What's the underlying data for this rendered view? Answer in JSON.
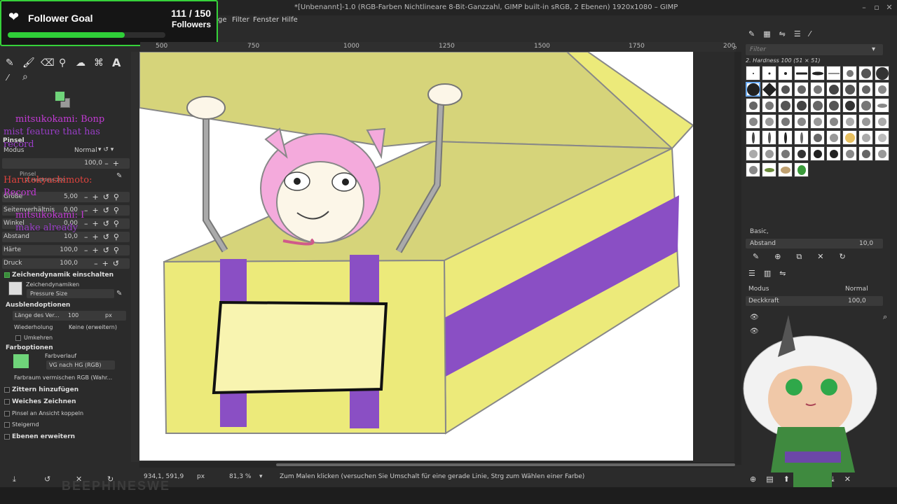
{
  "window": {
    "title": "*[Unbenannt]-1.0 (RGB-Farben Nichtlineare 8-Bit-Ganzzahl, GIMP built-in sRGB, 2 Ebenen) 1920x1080 – GIMP"
  },
  "menu": [
    "Filter",
    "Fenster",
    "Hilfe"
  ],
  "menu_partial": "ge",
  "follower_goal": {
    "title": "Follower Goal",
    "count": "111 / 150",
    "unit": "Followers",
    "progress": 0.74,
    "accent": "#2fcf38"
  },
  "ruler_labels": [
    "500",
    "750",
    "1000",
    "1250",
    "1500",
    "1750",
    "200"
  ],
  "tool_options": {
    "header": "Pinsel",
    "mode_label": "Modus",
    "mode_value": "Normal",
    "opacity_value": "100,0",
    "brush_label": "Pinsel",
    "brush_value": "2. Hardness 100",
    "size_label": "Größe",
    "size_value": "5,00",
    "ratio_label": "Seitenverhältnis",
    "ratio_value": "0,00",
    "angle_label": "Winkel",
    "angle_value": "0,00",
    "spacing_label": "Abstand",
    "spacing_value": "10,0",
    "hardness_label": "Härte",
    "hardness_value": "100,0",
    "pressure_label": "Druck",
    "pressure_value": "100,0",
    "dynamics_toggle": "Zeichendynamik einschalten",
    "dynamics_label": "Zeichendynamiken",
    "dynamics_value": "Pressure Size",
    "fade_section": "Ausblendoptionen",
    "fade_length_label": "Länge des Ver...",
    "fade_length_value": "100",
    "fade_unit": "px",
    "repeat_label": "Wiederholung",
    "repeat_value": "Keine (erweitern)",
    "reverse_label": "Umkehren",
    "color_section": "Farboptionen",
    "gradient_label": "Farbverlauf",
    "gradient_value": "VG nach HG (RGB)",
    "blend_space": "Farbraum vermischen RGB (Wahr...",
    "jitter": "Zittern hinzufügen",
    "smooth": "Weiches Zeichnen",
    "lock_view": "Pinsel an Ansicht koppeln",
    "incremental": "Steigernd",
    "expand": "Ebenen erweitern"
  },
  "chat": [
    {
      "text": "mitsukokami: Bonp",
      "color": "#c23bd4"
    },
    {
      "text": "mist feature that has",
      "color": "#9a3ec8"
    },
    {
      "text": "record",
      "color": "#9a3ec8"
    },
    {
      "text": "Harutokyashimoto:",
      "color": "#e0443e"
    },
    {
      "text": "Record",
      "color": "#c23bd4"
    },
    {
      "text": "mitsukokami: I",
      "color": "#c23bd4"
    },
    {
      "text": "make already",
      "color": "#9a3ec8"
    }
  ],
  "status": {
    "coords": "934,1, 591,9",
    "unit": "px",
    "zoom": "81,3 %",
    "hint": "Zum Malen klicken (versuchen Sie Umschalt für eine gerade Linie, Strg zum Wählen einer Farbe)"
  },
  "brushes_panel": {
    "filter_placeholder": "Filter",
    "selected": "2. Hardness 100 (51 × 51)",
    "preset": "Basic,",
    "spacing_label": "Abstand",
    "spacing_value": "10,0"
  },
  "layers_panel": {
    "mode_label": "Modus",
    "mode_value": "Normal",
    "opacity_label": "Deckkraft",
    "opacity_value": "100,0"
  },
  "colors": {
    "fg": "#6fd47a",
    "bg": "#999999",
    "canvas_bg": "#ffffff",
    "box_yellow": "#ecea7a",
    "box_purple": "#8a4fc4",
    "lid": "#d6d47a"
  },
  "watermark": "BEEPHINESWE"
}
